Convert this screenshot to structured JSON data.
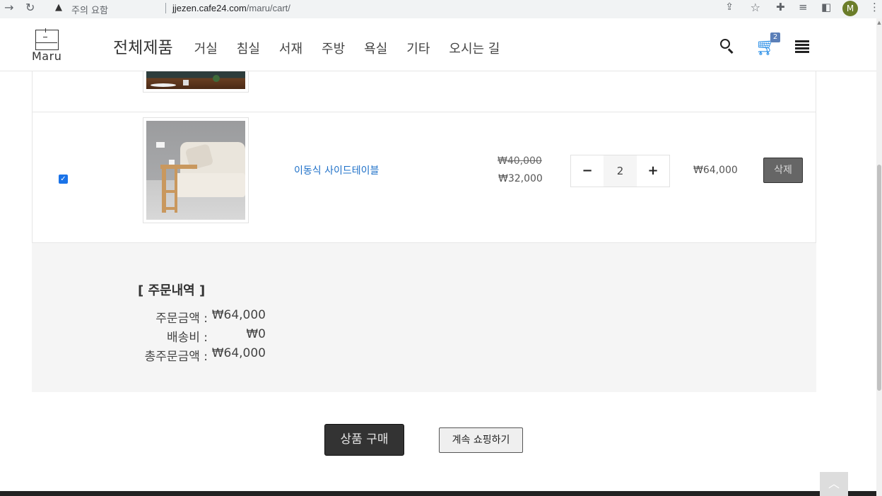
{
  "browser": {
    "security_label": "주의 요함",
    "url_host": "jjezen.cafe24.com",
    "url_path": "/maru/cart/",
    "profile_initial": "M"
  },
  "header": {
    "logo_text": "Maru",
    "nav_all": "전체제품",
    "nav_items": [
      "거실",
      "침실",
      "서재",
      "주방",
      "욕실",
      "기타",
      "오시는 길"
    ],
    "cart_count": "2"
  },
  "cart": {
    "item": {
      "checked": true,
      "name": "이동식 사이드테이블",
      "original_price": "₩40,000",
      "sale_price": "₩32,000",
      "quantity": "2",
      "minus_label": "−",
      "plus_label": "+",
      "line_total": "₩64,000",
      "delete_label": "삭제"
    }
  },
  "summary": {
    "title": "[ 주문내역 ]",
    "order_amount_label": "주문금액 :",
    "order_amount_value": "₩64,000",
    "shipping_label": "배송비 :",
    "shipping_value": "₩0",
    "total_label": "총주문금액 :",
    "total_value": "₩64,000"
  },
  "actions": {
    "buy_label": "상품 구매",
    "continue_label": "계속 쇼핑하기"
  },
  "colors": {
    "link": "#1e70c8",
    "cart_icon": "#1e88e5",
    "badge": "#5b7fb8"
  }
}
